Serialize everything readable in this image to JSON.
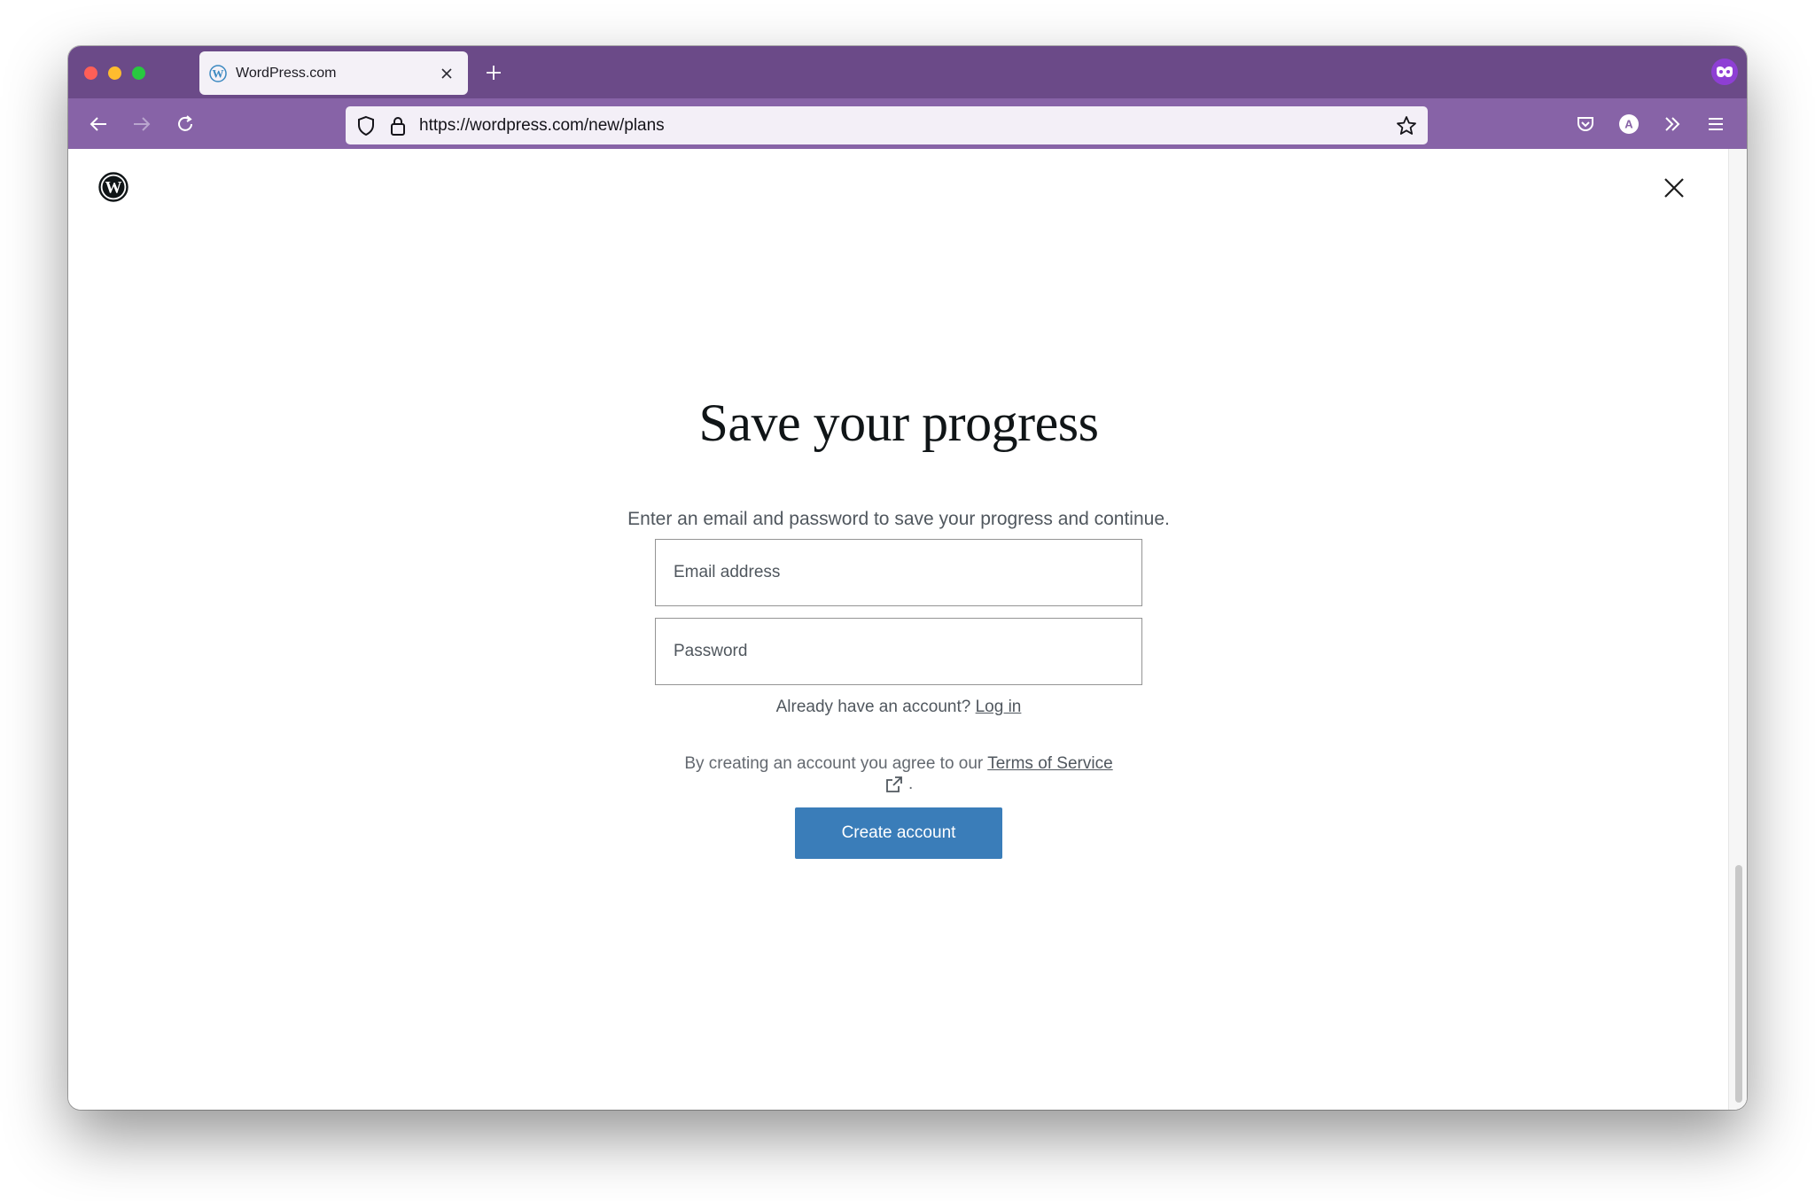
{
  "browser": {
    "tab_title": "WordPress.com",
    "url": "https://wordpress.com/new/plans"
  },
  "page": {
    "heading": "Save your progress",
    "subheading": "Enter an email and password to save your progress and continue.",
    "email_placeholder": "Email address",
    "password_placeholder": "Password",
    "login_prompt": "Already have an account?",
    "login_link": "Log in",
    "tos_prefix": "By creating an account you agree to our",
    "tos_link": "Terms of Service",
    "tos_suffix": ".",
    "create_button": "Create account"
  },
  "colors": {
    "titlebar": "#6b4a88",
    "toolbar": "#8763a7",
    "button": "#3a7db9"
  },
  "icons": [
    "wordpress-logo-icon",
    "close-icon",
    "back-icon",
    "forward-icon",
    "reload-icon",
    "shield-icon",
    "lock-icon",
    "bookmark-star-icon",
    "pocket-icon",
    "account-icon",
    "extensions-icon",
    "menu-icon",
    "external-link-icon",
    "private-browsing-icon"
  ]
}
